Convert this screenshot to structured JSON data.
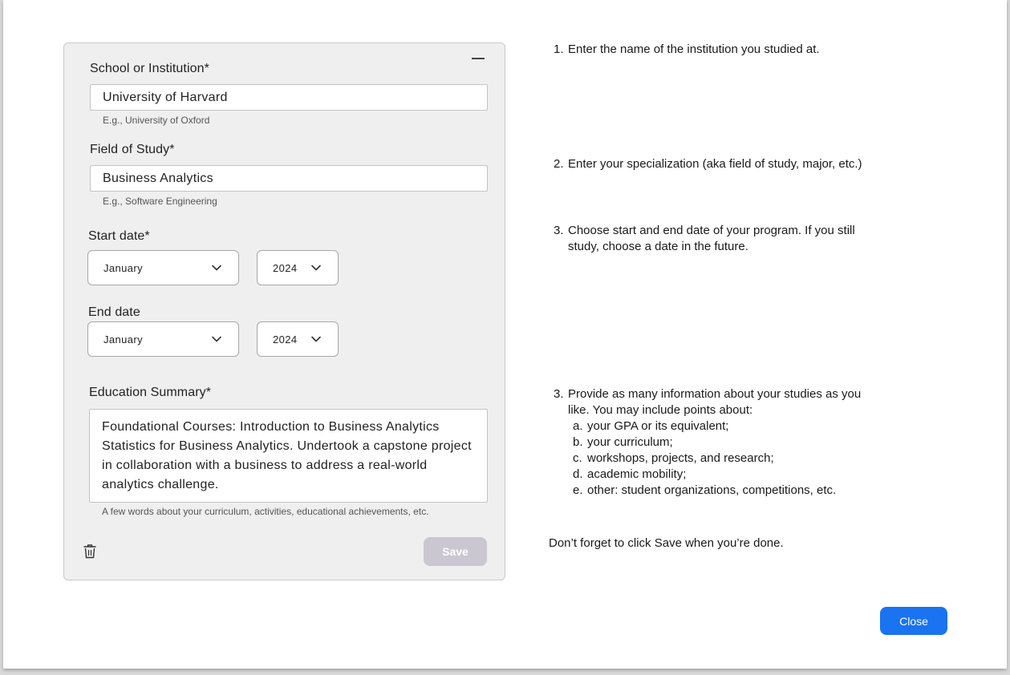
{
  "form": {
    "school": {
      "label": "School or Institution*",
      "value": "University of Harvard",
      "hint": "E.g., University of Oxford"
    },
    "field": {
      "label": "Field of Study*",
      "value": "Business Analytics",
      "hint": "E.g., Software Engineering"
    },
    "start_date": {
      "label": "Start date*",
      "month": "January",
      "year": "2024"
    },
    "end_date": {
      "label": "End date",
      "month": "January",
      "year": "2024"
    },
    "summary": {
      "label": "Education Summary*",
      "value": "Foundational Courses: Introduction to Business Analytics Statistics for Business Analytics. Undertook a capstone project in collaboration with a business to address a real-world analytics challenge.",
      "hint": "A few words about your curriculum, activities, educational achievements, etc."
    },
    "save_label": "Save",
    "icons": {
      "collapse": "minus-icon",
      "delete": "trash-icon",
      "dropdown": "chevron-down-icon"
    }
  },
  "instructions": {
    "step1": {
      "num": "1.",
      "text": "Enter the name of the institution you studied at."
    },
    "step2": {
      "num": "2.",
      "text": "Enter your specialization (aka field of study, major, etc.)"
    },
    "step3": {
      "num": "3.",
      "line1": "Choose start and end date of your program. If you still",
      "line2": "study, choose a date in the future."
    },
    "step4": {
      "num": "3.",
      "line1": "Provide as many information about your studies as you",
      "line2": "like. You may include points about:",
      "items": [
        {
          "letter": "a.",
          "text": "your GPA or its equivalent;"
        },
        {
          "letter": "b.",
          "text": "your curriculum;"
        },
        {
          "letter": "c.",
          "text": "workshops, projects, and research;"
        },
        {
          "letter": "d.",
          "text": "academic mobility;"
        },
        {
          "letter": "e.",
          "text": "other: student organizations, competitions, etc."
        }
      ]
    },
    "reminder": "Don’t forget to click Save when you’re done."
  },
  "close_label": "Close",
  "colors": {
    "primary": "#1a73f0",
    "save_disabled": "#cbc7d1",
    "card_bg": "#efefef"
  }
}
